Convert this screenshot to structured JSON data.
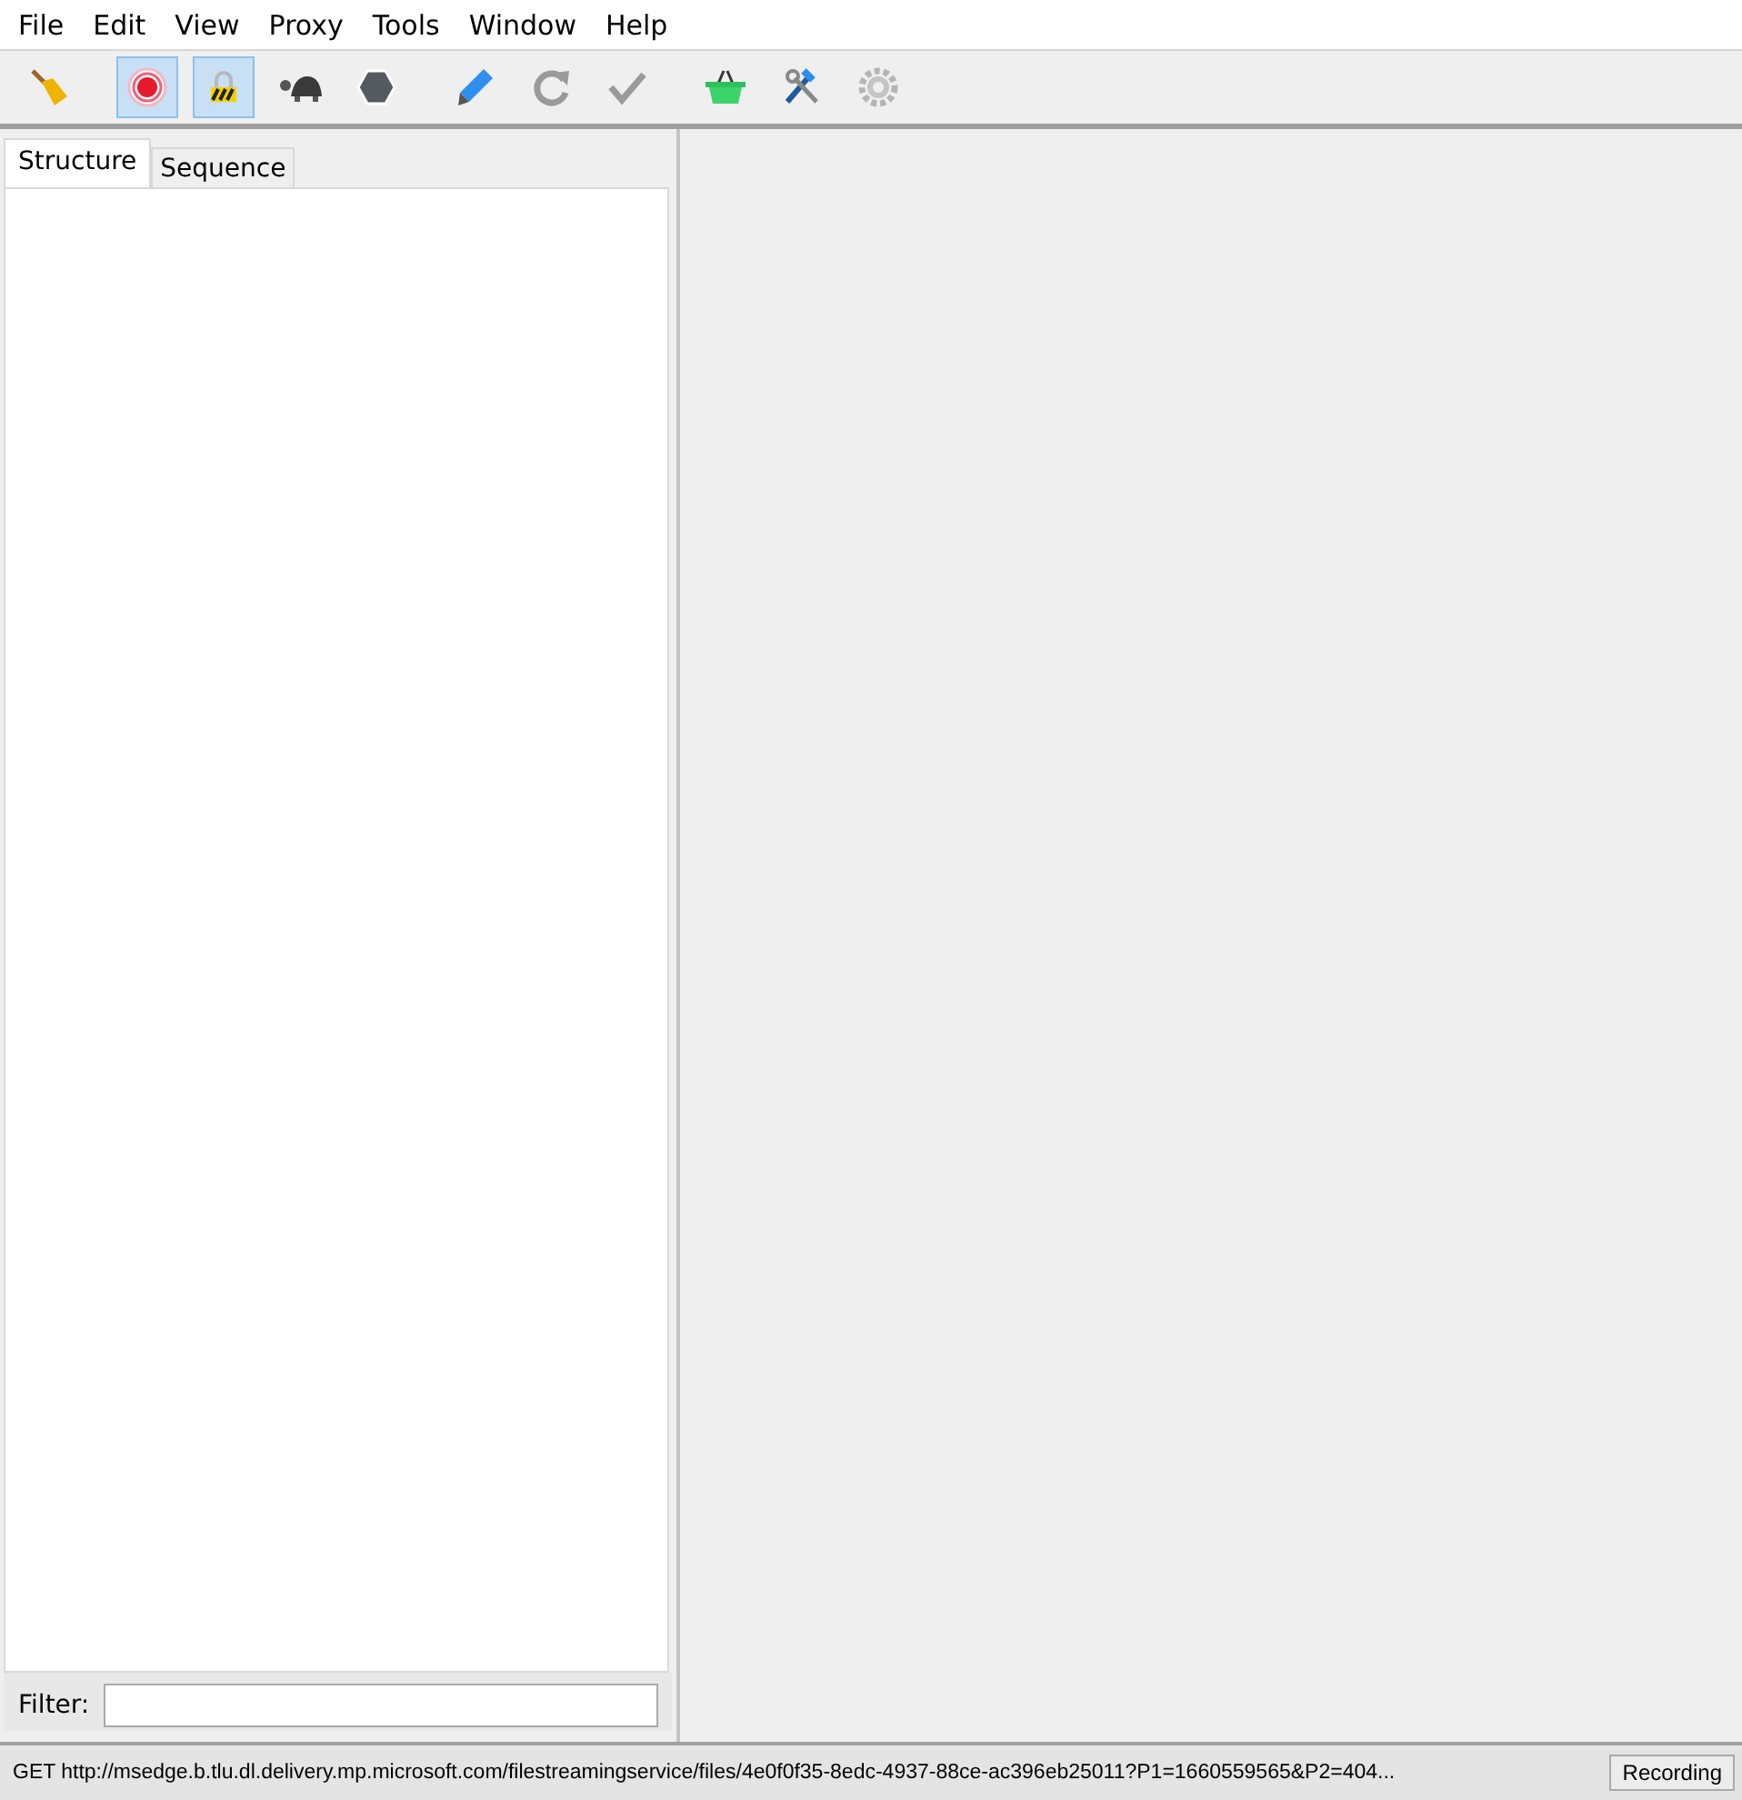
{
  "menu": [
    "File",
    "Edit",
    "View",
    "Proxy",
    "Tools",
    "Window",
    "Help"
  ],
  "toolbar": {
    "groups": [
      [
        {
          "kind": "broom",
          "pressed": false
        }
      ],
      [
        {
          "kind": "record",
          "pressed": true
        },
        {
          "kind": "lock",
          "pressed": true
        },
        {
          "kind": "turtle",
          "pressed": false
        },
        {
          "kind": "hexagon",
          "pressed": false
        }
      ],
      [
        {
          "kind": "pen",
          "pressed": false
        },
        {
          "kind": "refresh",
          "pressed": false
        },
        {
          "kind": "check",
          "pressed": false
        }
      ],
      [
        {
          "kind": "basket",
          "pressed": false
        },
        {
          "kind": "tools",
          "pressed": false
        },
        {
          "kind": "gear",
          "pressed": false
        }
      ]
    ]
  },
  "tabs": [
    {
      "label": "Structure",
      "selected": true
    },
    {
      "label": "Sequence",
      "selected": false
    }
  ],
  "filter": {
    "label": "Filter:"
  },
  "status_bar": {
    "text": "GET http://msedge.b.tlu.dl.delivery.mp.microsoft.com/filestreamingservice/files/4e0f0f35-8edc-4937-88ce-ac396eb25011?P1=1660559565&P2=404...",
    "button": "Recording"
  }
}
